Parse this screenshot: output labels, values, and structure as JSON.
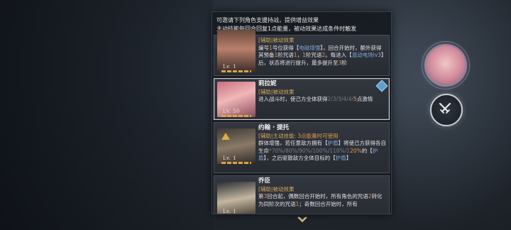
{
  "intro": {
    "line1": "可邀请下列角色支援持战，提供增益效果",
    "line2": "主动技能每回合回复1点能量，被动效果达成条件时触发"
  },
  "cards": [
    {
      "name": "",
      "level": "Lv. 1",
      "tag": "[辅助|被动效果",
      "desc_parts": [
        {
          "t": "编号",
          "c": "desc"
        },
        {
          "t": "1",
          "c": "hl-orange"
        },
        {
          "t": "号位获得【",
          "c": "desc"
        },
        {
          "t": "电磁增强",
          "c": "hl-blue"
        },
        {
          "t": "】，回合开始时，额外获得其预备",
          "c": "desc"
        },
        {
          "t": "1",
          "c": "hl-orange"
        },
        {
          "t": "阶咒语",
          "c": "desc"
        },
        {
          "t": "1",
          "c": "hl-orange"
        },
        {
          "t": "，",
          "c": "desc"
        },
        {
          "t": "1",
          "c": "hl-orange"
        },
        {
          "t": "阶咒语",
          "c": "desc"
        },
        {
          "t": "2",
          "c": "hl-orange"
        },
        {
          "t": "。每进入【",
          "c": "desc"
        },
        {
          "t": "混动电场lv3",
          "c": "hl-blue"
        },
        {
          "t": "】后，状态将进行提升，最多提升至",
          "c": "desc"
        },
        {
          "t": "3",
          "c": "hl-orange"
        },
        {
          "t": "阶",
          "c": "desc"
        }
      ]
    },
    {
      "name": "莉拉妮",
      "level": "LV. 50",
      "tag": "[辅助|被动效果",
      "desc_parts": [
        {
          "t": "进入战斗时，使己方全体获得",
          "c": "desc"
        },
        {
          "t": "2/3/3/4/4/",
          "c": "hl-gray"
        },
        {
          "t": "5",
          "c": "hl-orange"
        },
        {
          "t": "点激情",
          "c": "desc"
        }
      ]
    },
    {
      "name": "约翰 · 提托",
      "level": "Lv. 1",
      "tag": "[辅助|主动技能: ",
      "tag_extra": "3点能量时可使用",
      "desc_parts": [
        {
          "t": "群体增强，若任意敌方拥有【",
          "c": "desc"
        },
        {
          "t": "护盾",
          "c": "hl-blue"
        },
        {
          "t": "】将使己方获得各自生命",
          "c": "desc"
        },
        {
          "t": "*70%/80%/90%/100%/110%/1",
          "c": "hl-gray"
        },
        {
          "t": "20%",
          "c": "hl-orange"
        },
        {
          "t": "的【",
          "c": "desc"
        },
        {
          "t": "护盾",
          "c": "hl-blue"
        },
        {
          "t": "】，之后驱散敌方全体目标的【",
          "c": "desc"
        },
        {
          "t": "护盾",
          "c": "hl-blue"
        },
        {
          "t": "】",
          "c": "desc"
        }
      ]
    },
    {
      "name": "乔臣",
      "level": "Lv. 1",
      "tag": "[辅助|被动效果",
      "desc_parts": [
        {
          "t": "第",
          "c": "desc"
        },
        {
          "t": "3",
          "c": "hl-orange"
        },
        {
          "t": "回合起，偶数回合开始时，所有角色的咒语",
          "c": "desc"
        },
        {
          "t": "2",
          "c": "hl-orange"
        },
        {
          "t": "转化为同阶次的咒语",
          "c": "desc"
        },
        {
          "t": "1",
          "c": "hl-orange"
        },
        {
          "t": "；奇数回合开始时，所有",
          "c": "desc"
        }
      ]
    }
  ],
  "icons": {
    "scroll_down": "chevron-down-icon",
    "selected_badge": "diamond-icon",
    "side_action": "crossed-swords-icon"
  },
  "colors": {
    "accent_orange": "#e09a4a",
    "accent_blue": "#7fa6d6",
    "tag_gold": "#d5a85a"
  }
}
